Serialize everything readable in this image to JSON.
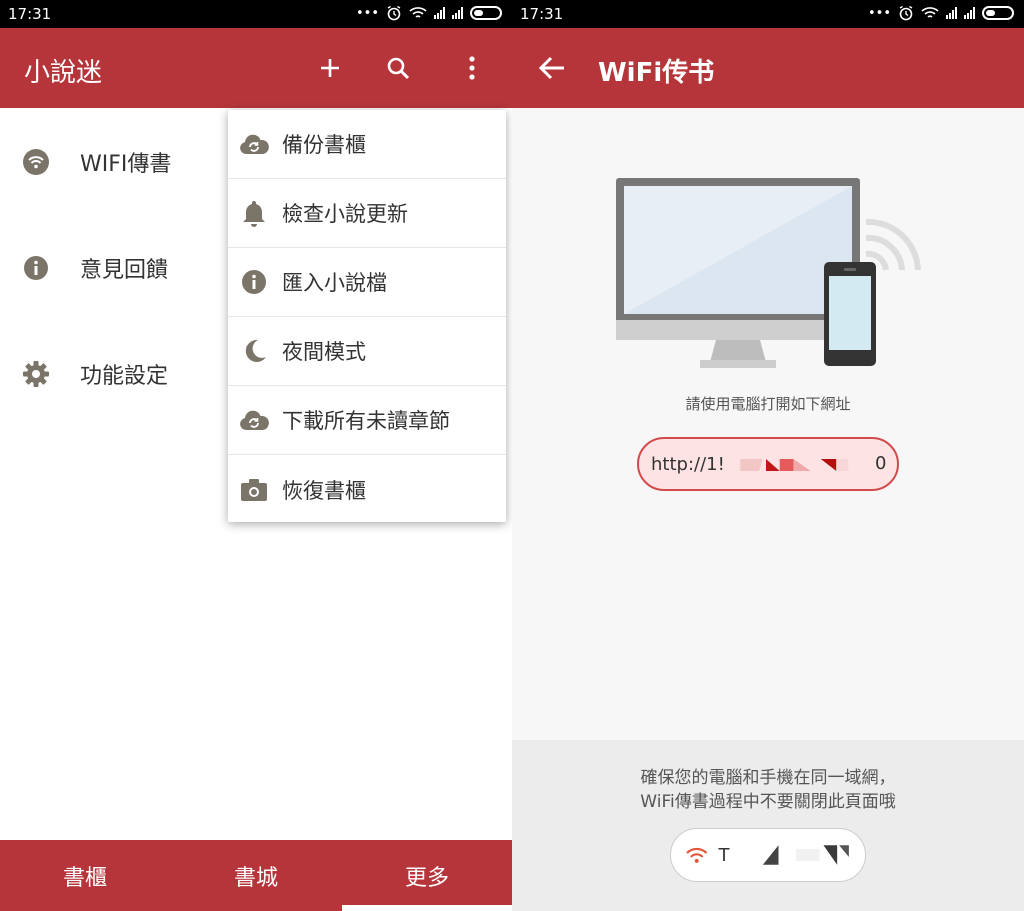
{
  "left_screen": {
    "status": {
      "time": "17:31",
      "dots": "•••"
    },
    "appbar": {
      "title": "小說迷",
      "add_icon": "plus-icon",
      "search_icon": "search-icon",
      "overflow_icon": "more-vert-icon"
    },
    "drawer": [
      {
        "label": "WIFI傳書",
        "icon": "wifi-icon"
      },
      {
        "label": "意見回饋",
        "icon": "info-icon"
      },
      {
        "label": "功能設定",
        "icon": "gear-icon"
      }
    ],
    "menu": [
      {
        "label": "備份書櫃",
        "icon": "cloud-sync-icon"
      },
      {
        "label": "檢查小說更新",
        "icon": "bell-icon"
      },
      {
        "label": "匯入小說檔",
        "icon": "info-icon"
      },
      {
        "label": "夜間模式",
        "icon": "moon-icon"
      },
      {
        "label": "下載所有未讀章節",
        "icon": "cloud-sync-icon"
      },
      {
        "label": "恢復書櫃",
        "icon": "camera-icon"
      }
    ],
    "bottom_nav": [
      {
        "label": "書櫃"
      },
      {
        "label": "書城"
      },
      {
        "label": "更多",
        "selected": true
      }
    ]
  },
  "right_screen": {
    "status": {
      "time": "17:31",
      "dots": "•••"
    },
    "appbar": {
      "title": "WiFi传书",
      "back_icon": "arrow-back-icon"
    },
    "instruction": "請使用電腦打開如下網址",
    "url": {
      "visible_start": "http://1!",
      "visible_end": "0"
    },
    "footer": {
      "line1": "確保您的電腦和手機在同一域網，",
      "line2": "WiFi傳書過程中不要關閉此頁面哦",
      "network": {
        "icon": "wifi-icon",
        "name": "T"
      }
    }
  },
  "colors": {
    "brand": "#b5353a",
    "icon_gray": "#7b7468",
    "wifi_orange": "#e2573a",
    "pill_bg": "#fde3e3"
  }
}
